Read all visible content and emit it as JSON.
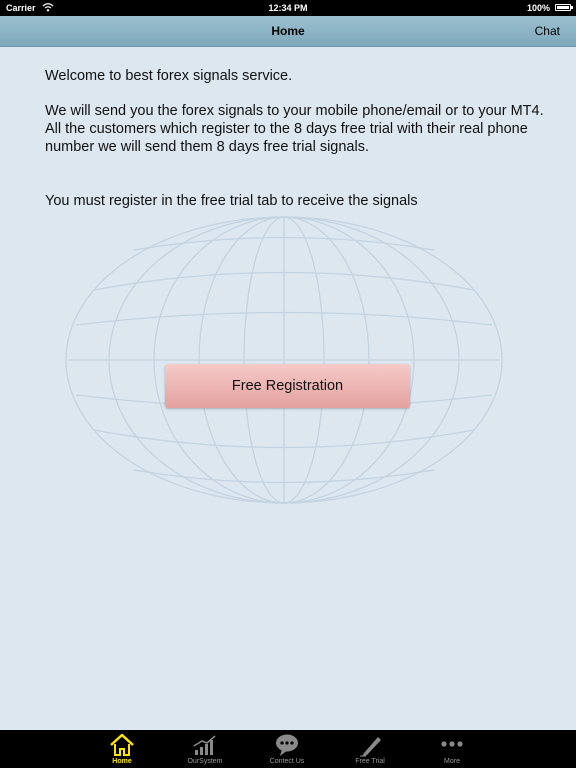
{
  "status_bar": {
    "carrier": "Carrier",
    "time": "12:34 PM",
    "battery": "100%"
  },
  "nav": {
    "title": "Home",
    "chat_label": "Chat"
  },
  "content": {
    "welcome": "Welcome to best forex signals service.",
    "description": "We will send you the forex signals to your mobile phone/email or to your MT4. All the customers which register to the 8 days free trial with their real phone number we will send them 8 days free trial signals.",
    "notice": "You must register in the free trial tab to receive the signals",
    "register_button": "Free Registration"
  },
  "tabs": [
    {
      "label": "Home",
      "icon": "home-icon",
      "active": true
    },
    {
      "label": "OurSystem",
      "icon": "bar-chart-icon",
      "active": false
    },
    {
      "label": "Contect Us",
      "icon": "chat-bubble-icon",
      "active": false
    },
    {
      "label": "Free Trial",
      "icon": "pen-icon",
      "active": false
    },
    {
      "label": "More",
      "icon": "more-dots-icon",
      "active": false
    }
  ],
  "colors": {
    "background": "#dde7f0",
    "nav_bar": "#8fb6c8",
    "button": "#eab4b2",
    "tab_active": "#ffe600",
    "tab_inactive": "#9a9a9a"
  }
}
